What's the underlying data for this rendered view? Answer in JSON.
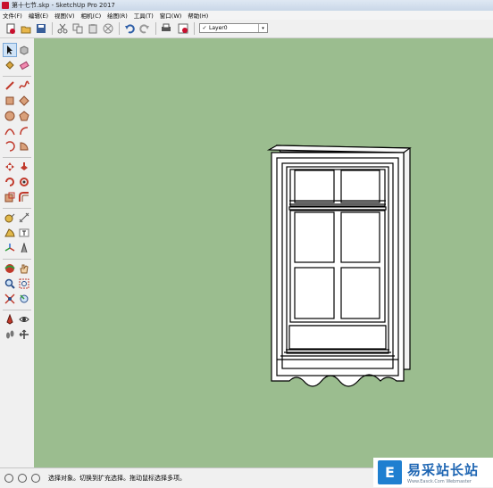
{
  "window": {
    "title": "第十七节.skp - SketchUp Pro 2017"
  },
  "menu": [
    {
      "label": "文件(F)"
    },
    {
      "label": "编辑(E)"
    },
    {
      "label": "视图(V)"
    },
    {
      "label": "相机(C)"
    },
    {
      "label": "绘图(R)"
    },
    {
      "label": "工具(T)"
    },
    {
      "label": "窗口(W)"
    },
    {
      "label": "帮助(H)"
    }
  ],
  "toolbar": {
    "icons": [
      "new-file-icon",
      "open-file-icon",
      "save-icon",
      "cut-icon",
      "copy-icon",
      "paste-icon",
      "erase-icon",
      "undo-icon",
      "redo-icon",
      "print-icon",
      "model-info-icon"
    ]
  },
  "layer": {
    "check": "✓",
    "name": "Layer0",
    "arrow": "▾"
  },
  "colors": {
    "viewport_background": "#9bbd8f",
    "model_line": "#000000",
    "model_fill": "#ffffff"
  },
  "status": {
    "message": "选择对象。切换到扩充选择。拖动鼠标选择多项。"
  },
  "watermark": {
    "logo": "E",
    "name": "易采站长站",
    "url": "Www.Easck.Com Webmaster"
  }
}
